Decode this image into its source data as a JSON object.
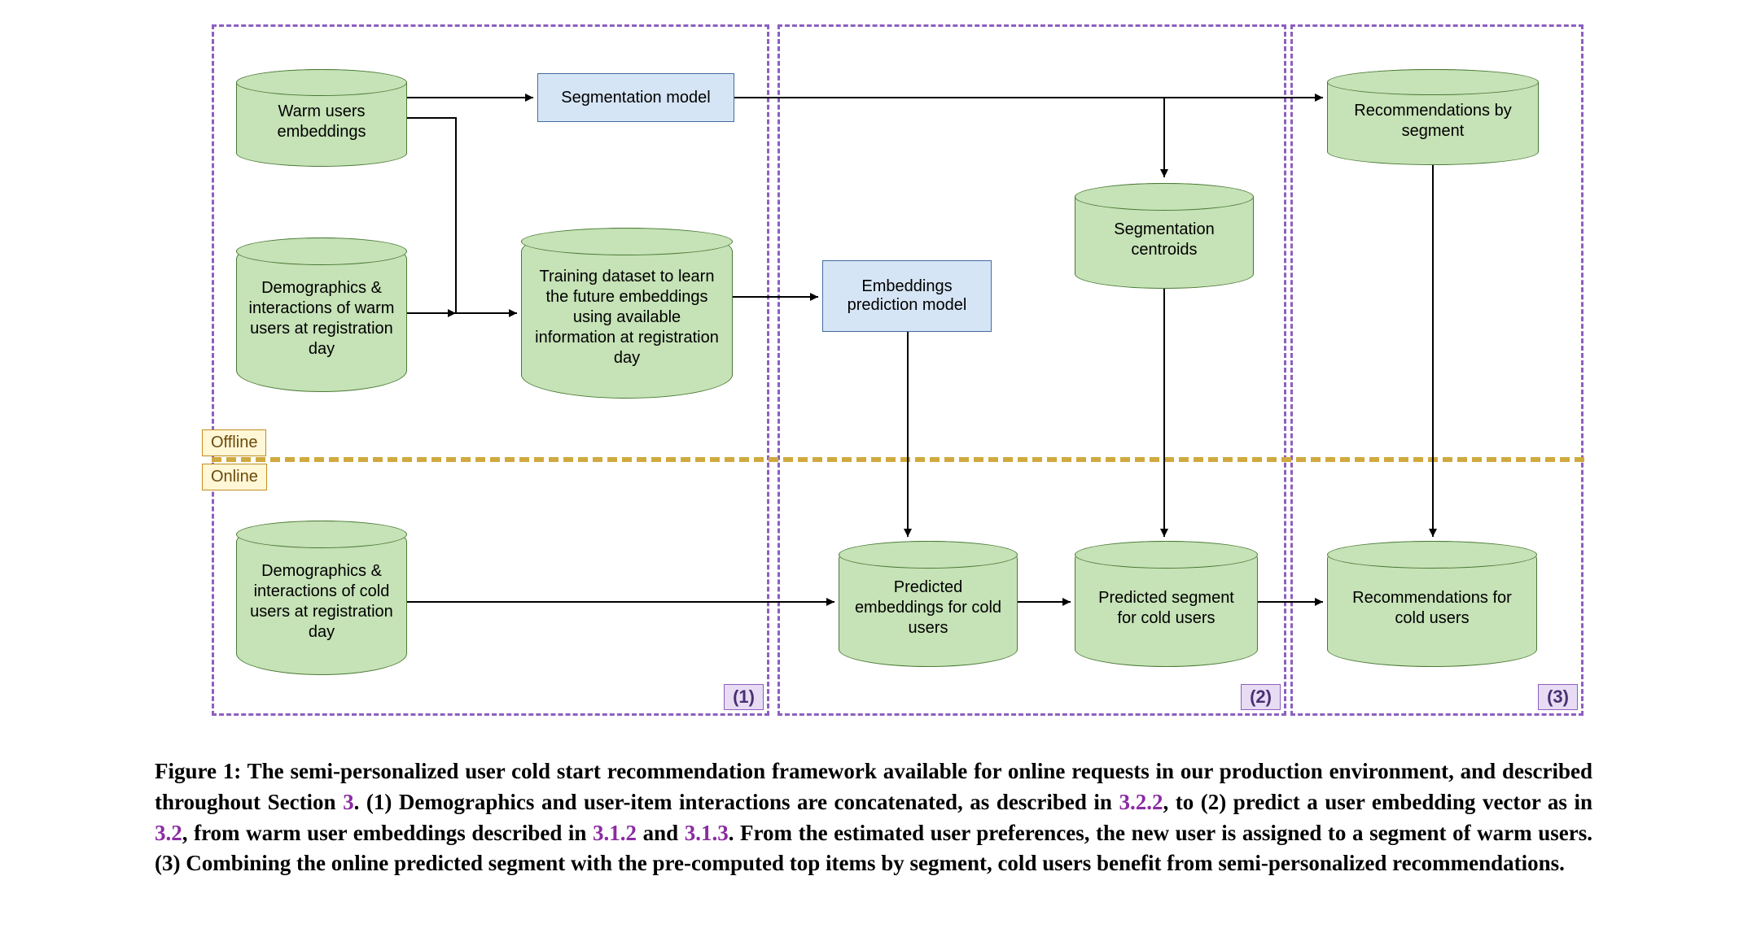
{
  "panels": {
    "p1": {
      "tag": "(1)"
    },
    "p2": {
      "tag": "(2)"
    },
    "p3": {
      "tag": "(3)"
    }
  },
  "labels": {
    "offline": "Offline",
    "online": "Online"
  },
  "boxes": {
    "seg_model": "Segmentation model",
    "emb_model_l1": "Embeddings",
    "emb_model_l2": "prediction model"
  },
  "cyl": {
    "warm_emb_l1": "Warm users",
    "warm_emb_l2": "embeddings",
    "demo_warm": "Demographics & interactions of warm users at registration day",
    "training": "Training dataset to learn the future embeddings using available information at registration day",
    "seg_centroids_l1": "Segmentation",
    "seg_centroids_l2": "centroids",
    "recs_by_seg_l1": "Recommendations by",
    "recs_by_seg_l2": "segment",
    "demo_cold": "Demographics & interactions of cold users at registration day",
    "pred_emb": "Predicted embeddings for cold users",
    "pred_seg": "Predicted segment for cold users",
    "recs_cold": "Recommendations for cold users"
  },
  "caption": {
    "prefix": "Figure 1: The semi-personalized user cold start recommendation framework available for online requests in our production environment, and described throughout Section ",
    "r1": "3",
    "s1": ". (1) Demographics and user-item interactions are concatenated, as described in ",
    "r2": "3.2.2",
    "s2": ", to (2) predict a user embedding vector as in ",
    "r3": "3.2",
    "s3": ", from warm user embeddings described in ",
    "r4": "3.1.2",
    "s4": " and ",
    "r5": "3.1.3",
    "s5": ". From the estimated user preferences, the new user is assigned to a segment of warm users. (3) Combining the online predicted segment with the pre-computed top items by segment, cold users benefit from semi-personalized recommendations."
  }
}
